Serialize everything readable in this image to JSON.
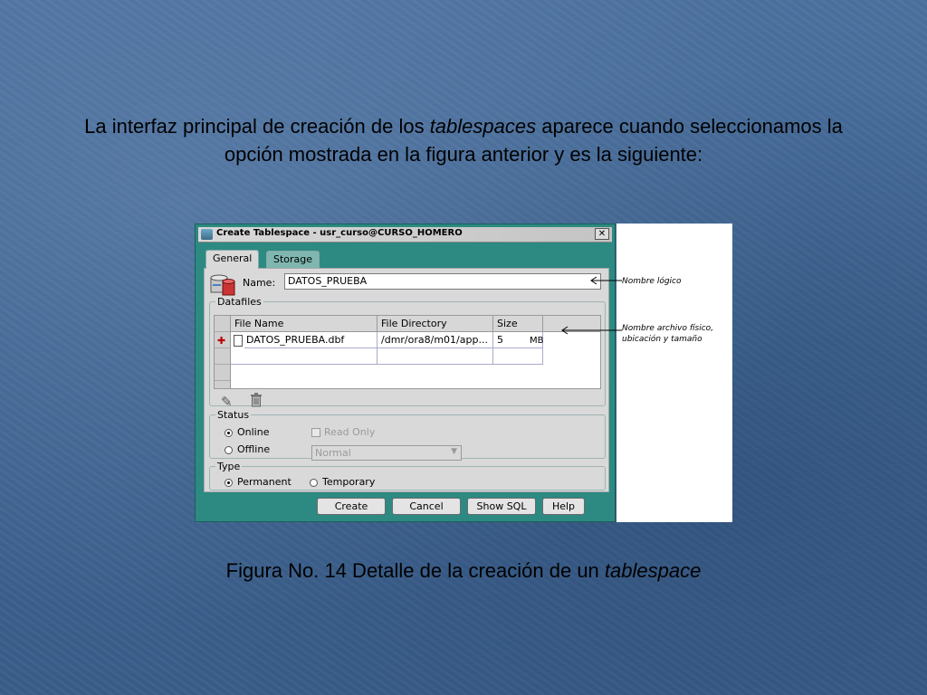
{
  "slide": {
    "intro_before": "La interfaz principal de creación de los ",
    "intro_em": "tablespaces",
    "intro_after_line1": " aparece cuando seleccionamos la",
    "intro_line2": "opción mostrada en la figura anterior y es la siguiente:",
    "caption_prefix": "Figura No. 14 Detalle de la creación de un ",
    "caption_em": "tablespace"
  },
  "dialog": {
    "title": "Create Tablespace - usr_curso@CURSO_HOMERO",
    "close_glyph": "✕",
    "tabs": [
      {
        "label": "General",
        "active": true
      },
      {
        "label": "Storage",
        "active": false
      }
    ],
    "name_label": "Name:",
    "name_value": "DATOS_PRUEBA",
    "datafiles": {
      "legend": "Datafiles",
      "columns": [
        "File Name",
        "File Directory",
        "Size"
      ],
      "rows": [
        {
          "file_name": "DATOS_PRUEBA.dbf",
          "file_directory": "/dmr/ora8/m01/app...",
          "size": "5",
          "unit": "MB"
        }
      ]
    },
    "status": {
      "legend": "Status",
      "online_label": "Online",
      "offline_label": "Offline",
      "selected": "Online",
      "read_only_label": "Read Only",
      "mode_value": "Normal"
    },
    "type": {
      "legend": "Type",
      "permanent_label": "Permanent",
      "temporary_label": "Temporary",
      "selected": "Permanent"
    },
    "buttons": {
      "create": "Create",
      "cancel": "Cancel",
      "show_sql": "Show SQL",
      "help": "Help"
    }
  },
  "annotations": {
    "logical_name": "Nombre lógico",
    "physical_line1": "Nombre archivo físico,",
    "physical_line2": "ubicación y tamaño"
  },
  "icons": {
    "edit": "pencil-icon",
    "delete": "trash-icon",
    "add_row": "add-row-icon",
    "file": "file-icon",
    "database": "database-icon"
  },
  "colors": {
    "slide_bg": "#416894",
    "dialog_frame": "#2c8a82",
    "panel": "#d9d9d9"
  }
}
